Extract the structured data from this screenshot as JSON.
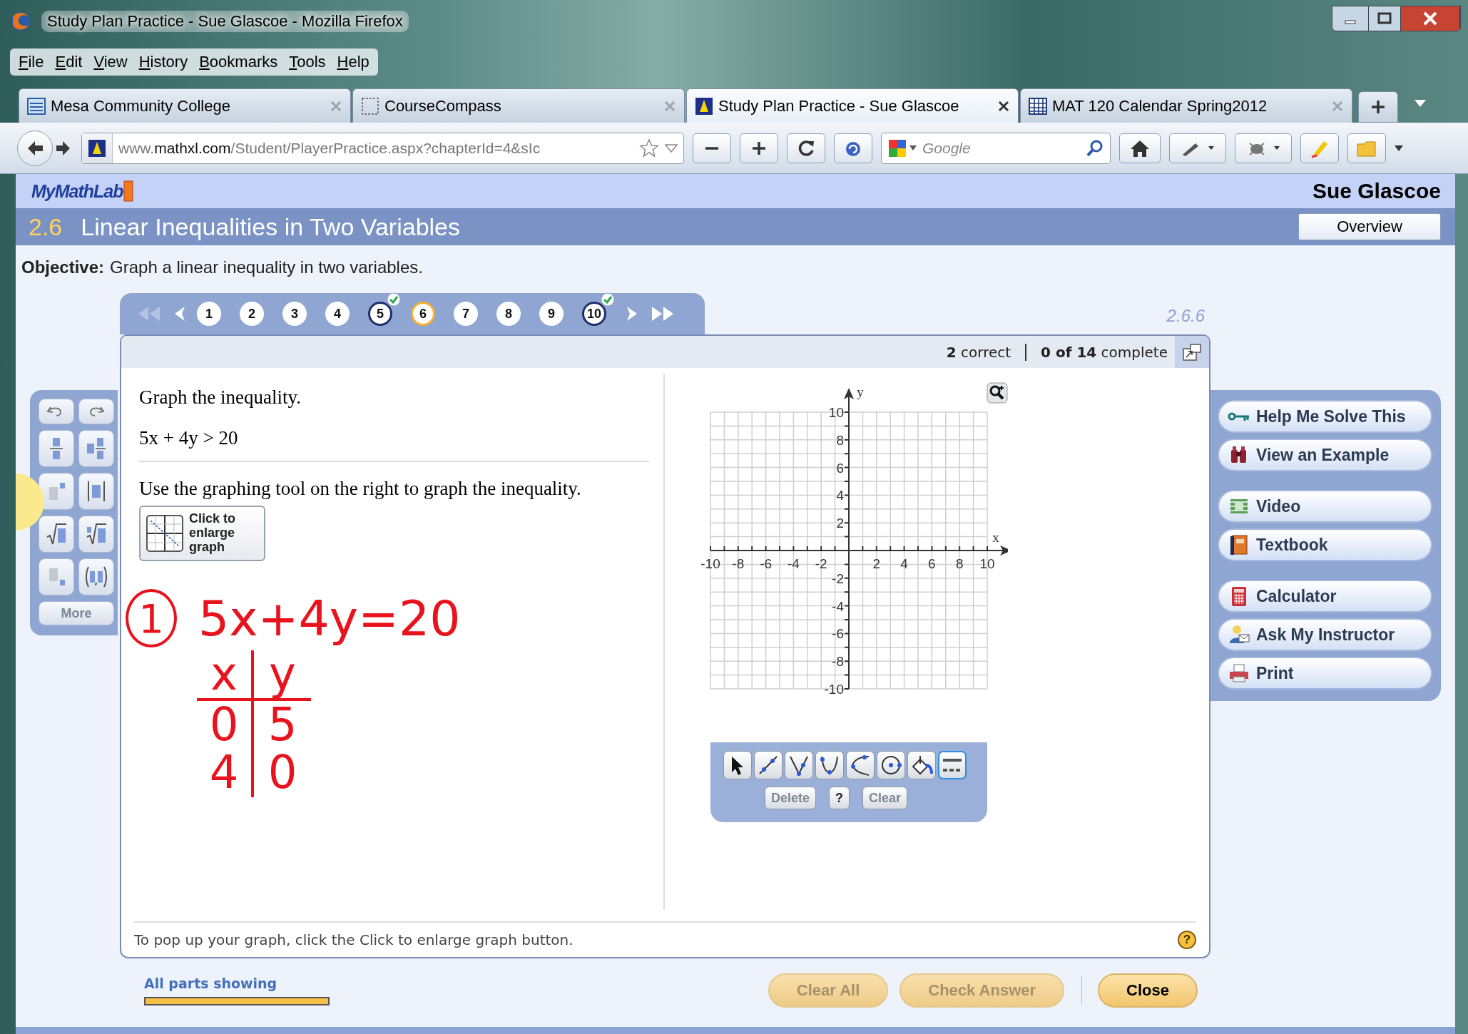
{
  "window": {
    "title": "Study Plan Practice - Sue Glascoe - Mozilla Firefox"
  },
  "menu": [
    "File",
    "Edit",
    "View",
    "History",
    "Bookmarks",
    "Tools",
    "Help"
  ],
  "tabs": [
    {
      "label": "Mesa Community College",
      "selected": false,
      "kind": "site"
    },
    {
      "label": "CourseCompass",
      "selected": false,
      "kind": "blank"
    },
    {
      "label": "Study Plan Practice - Sue Glascoe",
      "selected": true,
      "kind": "mathxl"
    },
    {
      "label": "MAT 120 Calendar Spring2012",
      "selected": false,
      "kind": "calendar"
    }
  ],
  "address": {
    "prefix": "www.",
    "domain": "mathxl.com",
    "path": "/Student/PlayerPractice.aspx?chapterId=4&sIc"
  },
  "search": {
    "placeholder": "Google"
  },
  "page": {
    "logo": "MyMathLab",
    "user": "Sue Glascoe",
    "section_number": "2.6",
    "section_title": "Linear Inequalities in Two Variables",
    "overview_button": "Overview",
    "objective_label": "Objective:",
    "objective": "Graph a linear inequality in two variables.",
    "question_id": "2.6.6"
  },
  "question_nav": [
    {
      "label": "1",
      "selected": false,
      "answered": false
    },
    {
      "label": "2",
      "selected": false,
      "answered": false
    },
    {
      "label": "3",
      "selected": false,
      "answered": false
    },
    {
      "label": "4",
      "selected": false,
      "answered": false
    },
    {
      "label": "5",
      "selected": false,
      "answered": true
    },
    {
      "label": "6",
      "selected": true,
      "answered": false
    },
    {
      "label": "7",
      "selected": false,
      "answered": false
    },
    {
      "label": "8",
      "selected": false,
      "answered": false
    },
    {
      "label": "9",
      "selected": false,
      "answered": false
    },
    {
      "label": "10",
      "selected": false,
      "answered": true
    }
  ],
  "status": {
    "correct": "**2** correct",
    "complete": "**0 of 14** complete"
  },
  "question": {
    "prompt": "Graph the inequality.",
    "inequality": "5x + 4y > 20",
    "instruction": "Use the graphing tool on the right to graph the inequality.",
    "enlarge_button": "Click to enlarge graph",
    "chart_data": {
      "type": "scatter",
      "grid": true,
      "xlabel": "x",
      "ylabel": "y",
      "xlim": [
        -10,
        10
      ],
      "ylim": [
        -10,
        10
      ],
      "xticks": [
        -10,
        -8,
        -6,
        -4,
        -2,
        2,
        4,
        6,
        8,
        10
      ],
      "yticks": [
        -10,
        -8,
        -6,
        -4,
        -2,
        2,
        4,
        6,
        8,
        10
      ]
    }
  },
  "graph_tools": [
    {
      "kind": "pointer",
      "selected": false
    },
    {
      "kind": "line",
      "selected": false
    },
    {
      "kind": "absolute",
      "selected": false
    },
    {
      "kind": "parabola",
      "selected": false
    },
    {
      "kind": "curve",
      "selected": false
    },
    {
      "kind": "circle",
      "selected": false
    },
    {
      "kind": "fill",
      "selected": false
    },
    {
      "kind": "linestyle",
      "selected": true
    }
  ],
  "graph_buttons": [
    {
      "label": "Delete",
      "disabled": true
    },
    {
      "label": "?",
      "disabled": false
    },
    {
      "label": "Clear",
      "disabled": true
    }
  ],
  "annotation": {
    "number": "1",
    "equation": "5x+4y=20",
    "table_header": [
      "x",
      "y"
    ],
    "table_rows": [
      [
        "0",
        "5"
      ],
      [
        "4",
        "0"
      ]
    ]
  },
  "footer": {
    "hint": "To pop up your graph, click the Click to enlarge graph button.",
    "help": "?"
  },
  "palette": {
    "more": "More",
    "more_disabled": true
  },
  "help_groups": [
    [
      {
        "kind": "key",
        "label": "Help Me Solve This"
      },
      {
        "kind": "binoculars",
        "label": "View an Example"
      }
    ],
    [
      {
        "kind": "film",
        "label": "Video"
      },
      {
        "kind": "book",
        "label": "Textbook"
      }
    ],
    [
      {
        "kind": "calculator",
        "label": "Calculator"
      },
      {
        "kind": "person",
        "label": "Ask My Instructor"
      },
      {
        "kind": "printer",
        "label": "Print"
      }
    ]
  ],
  "parts": {
    "label": "All parts showing",
    "level": 1
  },
  "actions": [
    {
      "label": "Clear All",
      "disabled": true
    },
    {
      "label": "Check Answer",
      "disabled": true
    },
    {
      "label": "Close",
      "disabled": false
    }
  ]
}
